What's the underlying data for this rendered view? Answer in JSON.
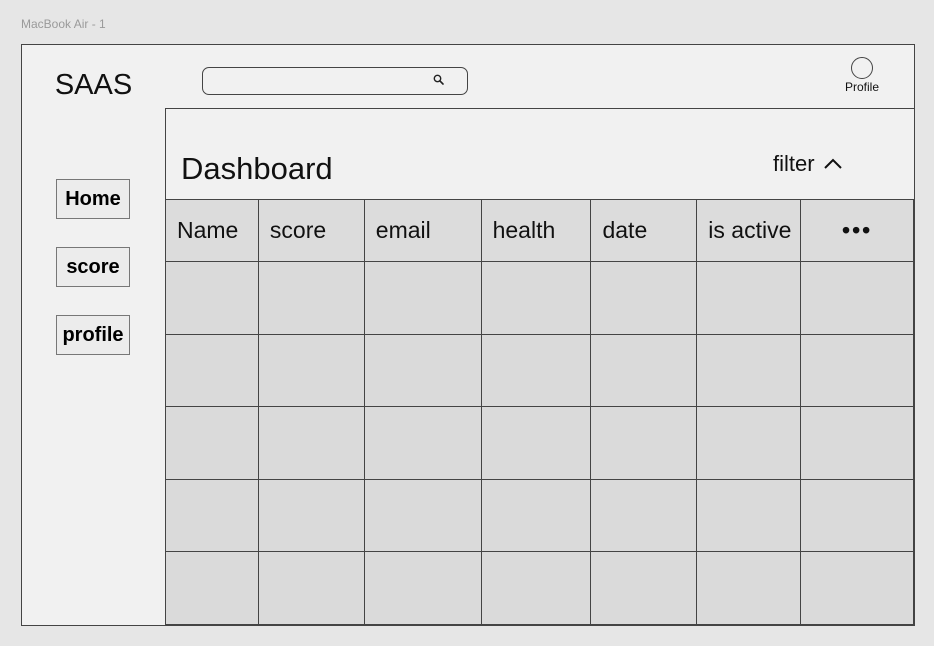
{
  "frame_label": "MacBook Air - 1",
  "sidebar": {
    "logo": "SAAS",
    "items": [
      {
        "label": "Home"
      },
      {
        "label": "score"
      },
      {
        "label": "profile"
      }
    ]
  },
  "topbar": {
    "search": {
      "placeholder": "",
      "icon": "search-icon"
    },
    "profile_label": "Profile"
  },
  "main": {
    "title": "Dashboard",
    "filter_label": "filter",
    "filter_icon": "chevron-up-icon"
  },
  "table": {
    "columns": [
      "Name",
      "score",
      "email",
      "health",
      "date",
      "is active",
      "•••"
    ],
    "rows": [
      [
        "",
        "",
        "",
        "",
        "",
        "",
        ""
      ],
      [
        "",
        "",
        "",
        "",
        "",
        "",
        ""
      ],
      [
        "",
        "",
        "",
        "",
        "",
        "",
        ""
      ],
      [
        "",
        "",
        "",
        "",
        "",
        "",
        ""
      ],
      [
        "",
        "",
        "",
        "",
        "",
        "",
        ""
      ]
    ]
  }
}
